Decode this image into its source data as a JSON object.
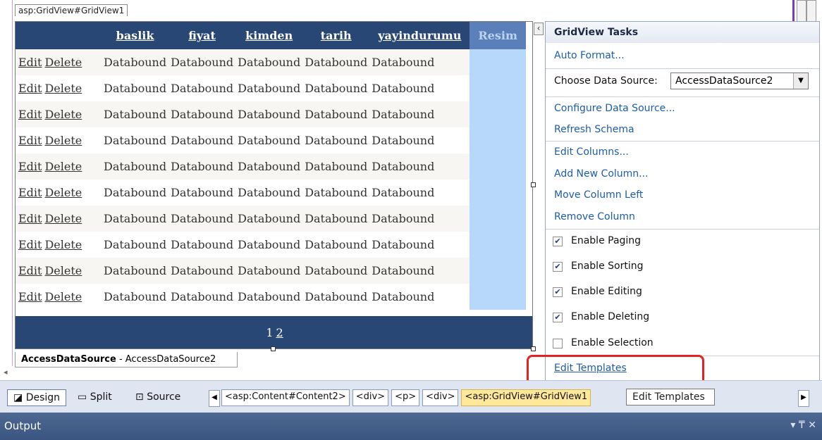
{
  "designer": {
    "control_tag": "asp:GridView#GridView1",
    "datasource_label_bold": "AccessDataSource",
    "datasource_label_rest": " - AccessDataSource2"
  },
  "grid": {
    "columns": [
      "",
      "baslik",
      "fiyat",
      "kimden",
      "tarih",
      "yayindurumu",
      "Resim"
    ],
    "edit_label": "Edit",
    "delete_label": "Delete",
    "cell_value": "Databound",
    "row_count": 10,
    "pager": {
      "current": "1",
      "other": "2"
    }
  },
  "tasks": {
    "title": "GridView Tasks",
    "auto_format": "Auto Format...",
    "choose_ds_label": "Choose Data Source:",
    "choose_ds_value": "AccessDataSource2",
    "configure_ds": "Configure Data Source...",
    "refresh_schema": "Refresh Schema",
    "edit_columns": "Edit Columns...",
    "add_column": "Add New Column...",
    "move_left": "Move Column Left",
    "remove_column": "Remove Column",
    "checks": [
      {
        "label": "Enable Paging",
        "checked": true
      },
      {
        "label": "Enable Sorting",
        "checked": true
      },
      {
        "label": "Enable Editing",
        "checked": true
      },
      {
        "label": "Enable Deleting",
        "checked": true
      },
      {
        "label": "Enable Selection",
        "checked": false
      }
    ],
    "edit_templates": "Edit Templates",
    "tooltip": "Edit Templates"
  },
  "statusbar": {
    "design": "Design",
    "split": "Split",
    "source": "Source",
    "crumbs": [
      "<asp:Content#Content2>",
      "<div>",
      "<p>",
      "<div>",
      "<asp:GridView#GridView1"
    ]
  },
  "output": {
    "title": "Output",
    "controls": "▾ ₸ ✕"
  },
  "colors": {
    "header": "#284775",
    "resim_col": "#b7d7fb",
    "highlight": "#e32222",
    "link": "#1c5dab"
  }
}
